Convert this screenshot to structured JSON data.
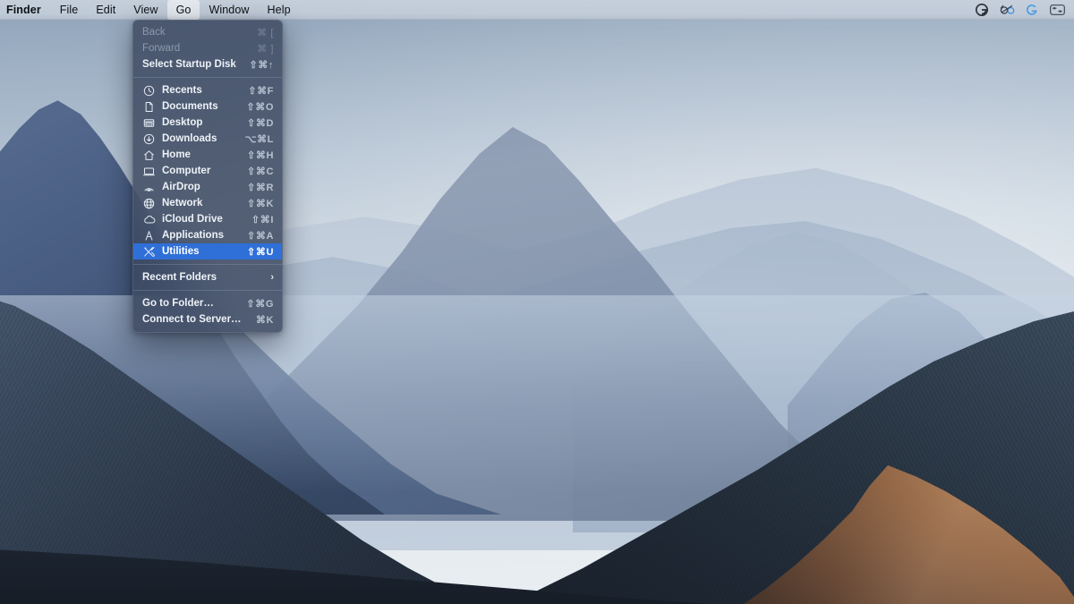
{
  "menubar": {
    "apple_icon": "apple-logo-icon",
    "app_name": "Finder",
    "items": [
      {
        "label": "File",
        "open": false
      },
      {
        "label": "Edit",
        "open": false
      },
      {
        "label": "View",
        "open": false
      },
      {
        "label": "Go",
        "open": true
      },
      {
        "label": "Window",
        "open": false
      },
      {
        "label": "Help",
        "open": false
      }
    ],
    "status_icons": [
      {
        "name": "grammarly-icon",
        "glyph": "G",
        "color": "#2b3138",
        "style": "circle-dark"
      },
      {
        "name": "eyeglasses-icon",
        "glyph": "◎",
        "color": "#33414f",
        "style": "glasses"
      },
      {
        "name": "logitech-options-icon",
        "glyph": "G",
        "color": "#4f9fe0",
        "style": "logi"
      },
      {
        "name": "control-center-icon",
        "glyph": "☷",
        "color": "#3c4752",
        "style": "switcher"
      }
    ]
  },
  "go_menu": {
    "title": "Go",
    "sections": [
      {
        "rows": [
          {
            "label": "Back",
            "shortcut": "⌘ [",
            "disabled": true,
            "icon": null,
            "bold": false,
            "selected": false,
            "submenu": false
          },
          {
            "label": "Forward",
            "shortcut": "⌘ ]",
            "disabled": true,
            "icon": null,
            "bold": false,
            "selected": false,
            "submenu": false
          },
          {
            "label": "Select Startup Disk",
            "shortcut": "⇧⌘↑",
            "disabled": false,
            "icon": null,
            "bold": true,
            "selected": false,
            "submenu": false
          }
        ]
      },
      {
        "rows": [
          {
            "label": "Recents",
            "shortcut": "⇧⌘F",
            "disabled": false,
            "icon": "clock-icon",
            "bold": true,
            "selected": false,
            "submenu": false
          },
          {
            "label": "Documents",
            "shortcut": "⇧⌘O",
            "disabled": false,
            "icon": "document-icon",
            "bold": true,
            "selected": false,
            "submenu": false
          },
          {
            "label": "Desktop",
            "shortcut": "⇧⌘D",
            "disabled": false,
            "icon": "desktop-icon",
            "bold": true,
            "selected": false,
            "submenu": false
          },
          {
            "label": "Downloads",
            "shortcut": "⌥⌘L",
            "disabled": false,
            "icon": "download-icon",
            "bold": true,
            "selected": false,
            "submenu": false
          },
          {
            "label": "Home",
            "shortcut": "⇧⌘H",
            "disabled": false,
            "icon": "home-icon",
            "bold": true,
            "selected": false,
            "submenu": false
          },
          {
            "label": "Computer",
            "shortcut": "⇧⌘C",
            "disabled": false,
            "icon": "computer-icon",
            "bold": true,
            "selected": false,
            "submenu": false
          },
          {
            "label": "AirDrop",
            "shortcut": "⇧⌘R",
            "disabled": false,
            "icon": "airdrop-icon",
            "bold": true,
            "selected": false,
            "submenu": false
          },
          {
            "label": "Network",
            "shortcut": "⇧⌘K",
            "disabled": false,
            "icon": "network-globe-icon",
            "bold": true,
            "selected": false,
            "submenu": false
          },
          {
            "label": "iCloud Drive",
            "shortcut": "⇧⌘I",
            "disabled": false,
            "icon": "icloud-icon",
            "bold": true,
            "selected": false,
            "submenu": false
          },
          {
            "label": "Applications",
            "shortcut": "⇧⌘A",
            "disabled": false,
            "icon": "applications-icon",
            "bold": true,
            "selected": false,
            "submenu": false
          },
          {
            "label": "Utilities",
            "shortcut": "⇧⌘U",
            "disabled": false,
            "icon": "utilities-tools-icon",
            "bold": true,
            "selected": true,
            "submenu": false
          }
        ]
      },
      {
        "rows": [
          {
            "label": "Recent Folders",
            "shortcut": "",
            "disabled": false,
            "icon": null,
            "bold": true,
            "selected": false,
            "submenu": true
          }
        ]
      },
      {
        "rows": [
          {
            "label": "Go to Folder…",
            "shortcut": "⇧⌘G",
            "disabled": false,
            "icon": null,
            "bold": true,
            "selected": false,
            "submenu": false
          },
          {
            "label": "Connect to Server…",
            "shortcut": "⌘K",
            "disabled": false,
            "icon": null,
            "bold": true,
            "selected": false,
            "submenu": false
          }
        ]
      }
    ]
  },
  "colors": {
    "menu_highlight": "#2f6fd8",
    "menu_background": "rgba(58,70,92,0.82)",
    "menubar_background": "#c9d2dd",
    "menu_text": "#eef2f7",
    "menu_text_disabled": "#8e99ab",
    "shortcut_text": "#b7c1d1"
  },
  "wallpaper": {
    "name": "mojave-mountain-landscape",
    "description": "Layered blue mountain ridges at dawn with sunlit warm ridge lower right"
  }
}
